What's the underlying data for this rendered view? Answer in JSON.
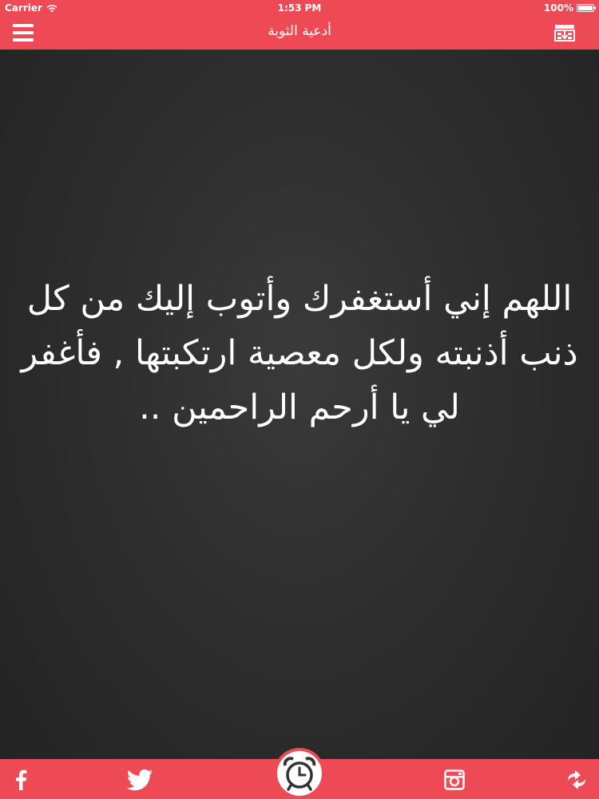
{
  "status_bar": {
    "carrier": "Carrier",
    "time": "1:53 PM",
    "battery_text": "100%",
    "battery_level": 1.0
  },
  "nav": {
    "title": "أدعية الثوبة",
    "menu_icon": "hamburger-menu-icon",
    "download_icon": "download-box-icon"
  },
  "content": {
    "dua_text": "اللهم إني أستغفرك وأتوب إليك من كل ذنب أذنبته ولكل معصية ارتكبتها , فأغفر لي يا أرحم الراحمين .."
  },
  "bottom_bar": {
    "icons": [
      "facebook-icon",
      "twitter-icon",
      "alarm-clock-icon",
      "instagram-icon",
      "share-arrows-icon"
    ]
  },
  "colors": {
    "accent": "#ee4a55",
    "background": "#2e2e2e",
    "text": "#ffffff"
  }
}
